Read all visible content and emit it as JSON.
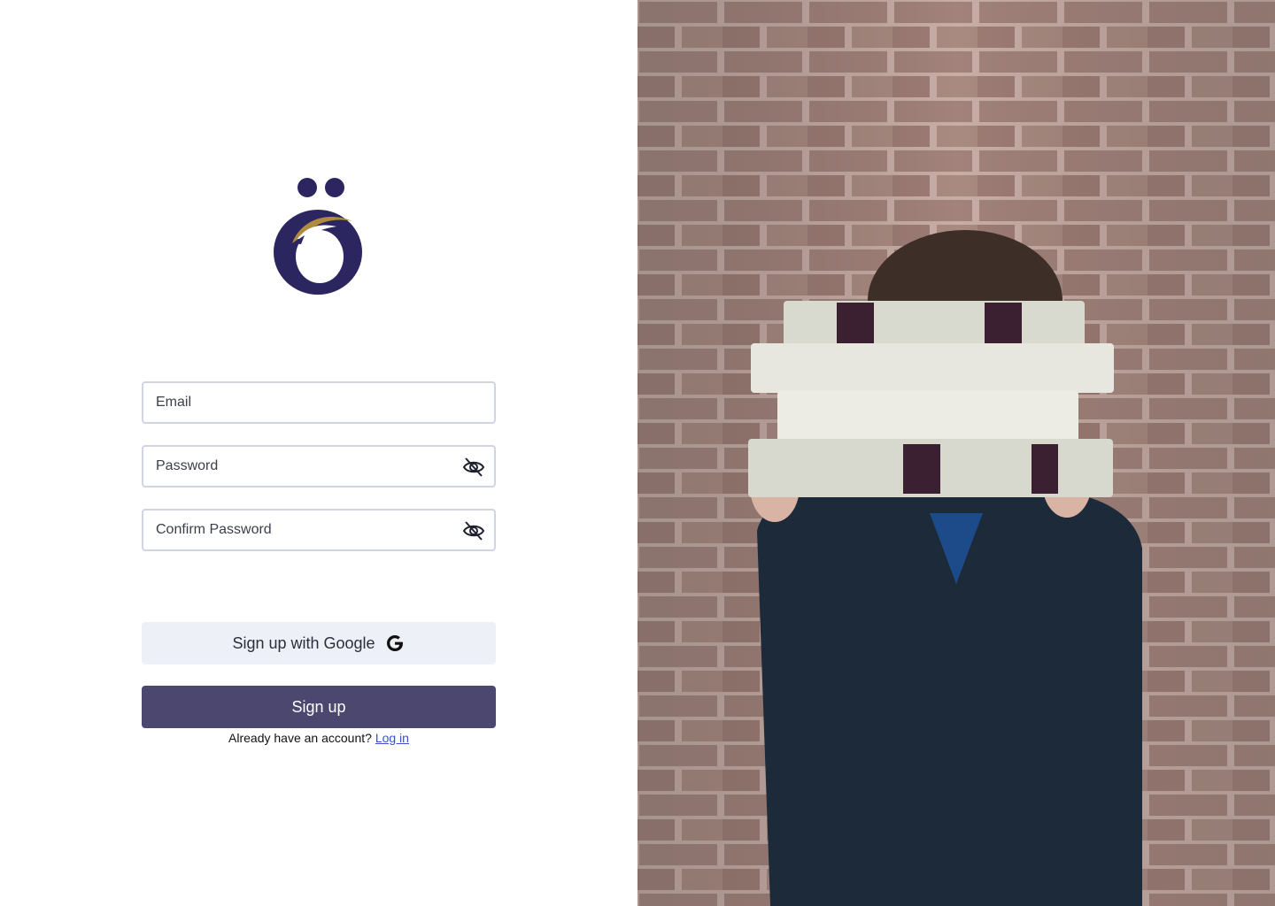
{
  "colors": {
    "brand_navy": "#2b2660",
    "brand_gold": "#b08a3e",
    "primary_button": "#4b476f",
    "secondary_button": "#edf0f7",
    "link": "#3a4fd1",
    "field_border": "#d2d5e0"
  },
  "form": {
    "email_placeholder": "Email",
    "password_placeholder": "Password",
    "confirm_password_placeholder": "Confirm Password",
    "password_toggle_icon": "eye-off-icon",
    "confirm_toggle_icon": "eye-off-icon"
  },
  "actions": {
    "google_label": "Sign up with Google",
    "google_icon": "google-g-icon",
    "signup_label": "Sign up"
  },
  "footer": {
    "prompt": "Already have an account?",
    "login_link": "Log in"
  },
  "hero": {
    "image_subject": "person holding stack of encyclopedia books in front of brick wall"
  }
}
